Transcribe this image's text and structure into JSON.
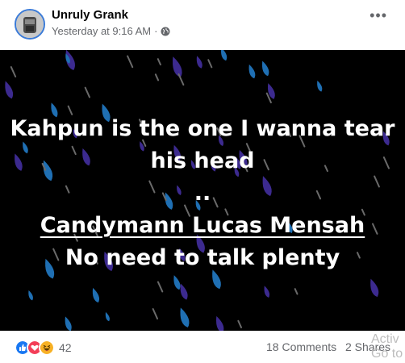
{
  "post": {
    "author": "Unruly Grank",
    "timestamp": "Yesterday at 9:16 AM",
    "separator": "·",
    "privacy_icon": "globe-icon",
    "more_icon": "more-options-icon",
    "more_label": "•••"
  },
  "media": {
    "background": "#000000",
    "lines": [
      "Kahpun is the one I wanna tear",
      "his head",
      "..",
      "Candymann Lucas Mensah",
      "No need to talk plenty"
    ],
    "colors": {
      "text": "#ffffff",
      "purple_drop": "#3c2a8f",
      "blue_drop": "#1f6fb3"
    }
  },
  "footer": {
    "reaction_icons": [
      "like-icon",
      "love-icon",
      "haha-icon"
    ],
    "reaction_count": "42",
    "comments": "18 Comments",
    "shares": "2 Shares",
    "watermark_line1": "Activ",
    "watermark_line2": "Go to"
  }
}
